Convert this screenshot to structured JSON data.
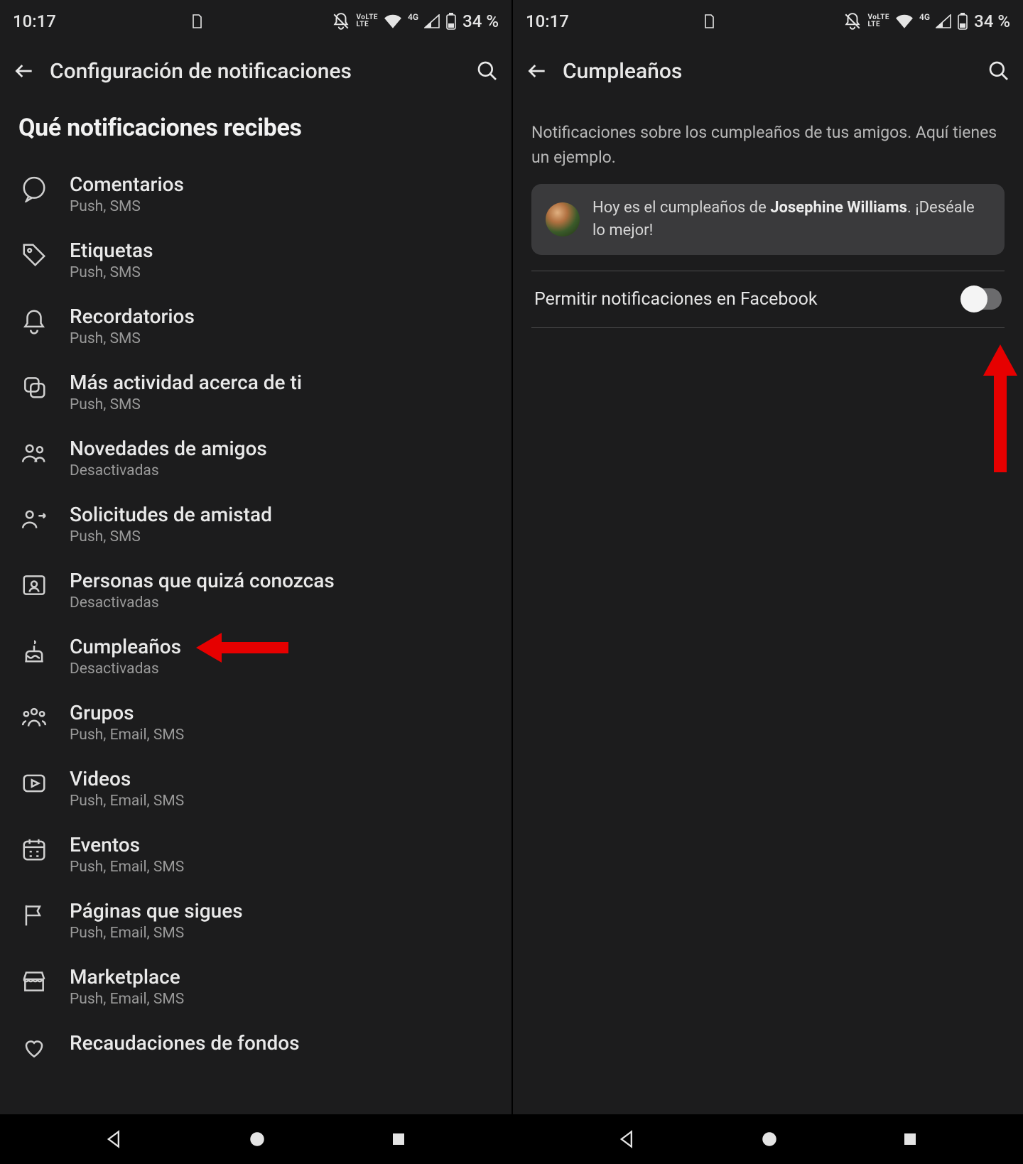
{
  "status": {
    "time": "10:17",
    "lte_top": "VoLTE",
    "lte_bot": "LTE",
    "net_label": "4G",
    "battery": "34 %"
  },
  "left": {
    "header_title": "Configuración de notificaciones",
    "section_title": "Qué notificaciones recibes",
    "items": [
      {
        "title": "Comentarios",
        "sub": "Push, SMS"
      },
      {
        "title": "Etiquetas",
        "sub": "Push, SMS"
      },
      {
        "title": "Recordatorios",
        "sub": "Push, SMS"
      },
      {
        "title": "Más actividad acerca de ti",
        "sub": "Push, SMS"
      },
      {
        "title": "Novedades de amigos",
        "sub": "Desactivadas"
      },
      {
        "title": "Solicitudes de amistad",
        "sub": "Push, SMS"
      },
      {
        "title": "Personas que quizá conozcas",
        "sub": "Desactivadas"
      },
      {
        "title": "Cumpleaños",
        "sub": "Desactivadas"
      },
      {
        "title": "Grupos",
        "sub": "Push, Email, SMS"
      },
      {
        "title": "Videos",
        "sub": "Push, Email, SMS"
      },
      {
        "title": "Eventos",
        "sub": "Push, Email, SMS"
      },
      {
        "title": "Páginas que sigues",
        "sub": "Push, Email, SMS"
      },
      {
        "title": "Marketplace",
        "sub": "Push, Email, SMS"
      },
      {
        "title": "Recaudaciones de fondos",
        "sub": ""
      }
    ]
  },
  "right": {
    "header_title": "Cumpleaños",
    "description": "Notificaciones sobre los cumpleaños de tus amigos. Aquí tienes un ejemplo.",
    "example_prefix": "Hoy es el cumpleaños de ",
    "example_name": "Josephine Williams",
    "example_suffix": ". ¡Deséale lo mejor!",
    "toggle_label": "Permitir notificaciones en Facebook",
    "toggle_on": false
  }
}
